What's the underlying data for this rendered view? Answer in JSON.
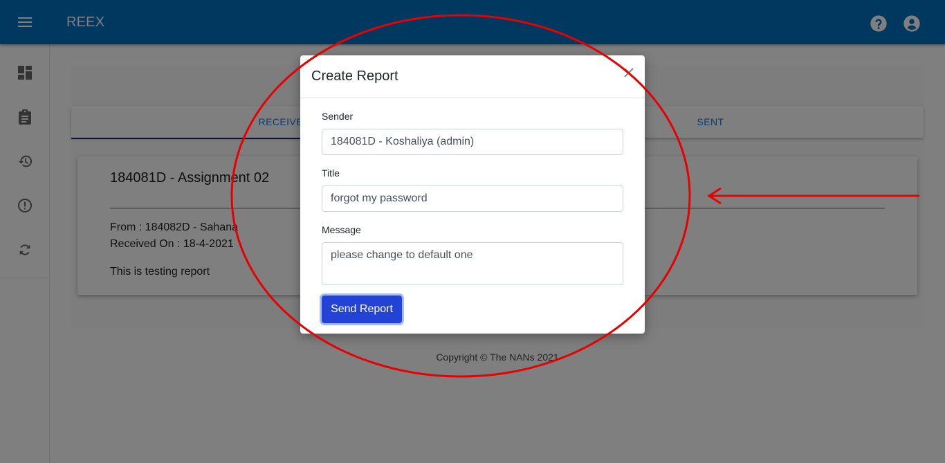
{
  "appbar": {
    "title": "REEX",
    "menu_icon": "menu-icon",
    "help_icon": "help-icon",
    "account_icon": "account-icon"
  },
  "sidebar": {
    "items": [
      {
        "icon": "dashboard-icon"
      },
      {
        "icon": "clipboard-icon"
      },
      {
        "icon": "history-icon"
      },
      {
        "icon": "alert-icon"
      },
      {
        "icon": "sync-icon"
      }
    ]
  },
  "tabs": [
    {
      "label": "RECEIVED",
      "active": true
    },
    {
      "label": "SENT",
      "active": false
    }
  ],
  "report": {
    "title": "184081D - Assignment 02",
    "from": "From : 184082D - Sahana",
    "received_on": "Received On : 18-4-2021",
    "message": "This is testing report"
  },
  "footer": "Copyright © The NANs 2021",
  "modal": {
    "title": "Create Report",
    "close_icon": "close-icon",
    "sender_label": "Sender",
    "sender_value": "184081D - Koshaliya (admin)",
    "title_label": "Title",
    "title_value": "forgot my password",
    "message_label": "Message",
    "message_value": "please change to default one",
    "send_label": "Send Report"
  },
  "colors": {
    "appbar": "#0070c0",
    "primary_button": "#2343d7",
    "tab_text": "#1976d2",
    "annotation": "#e60000"
  }
}
